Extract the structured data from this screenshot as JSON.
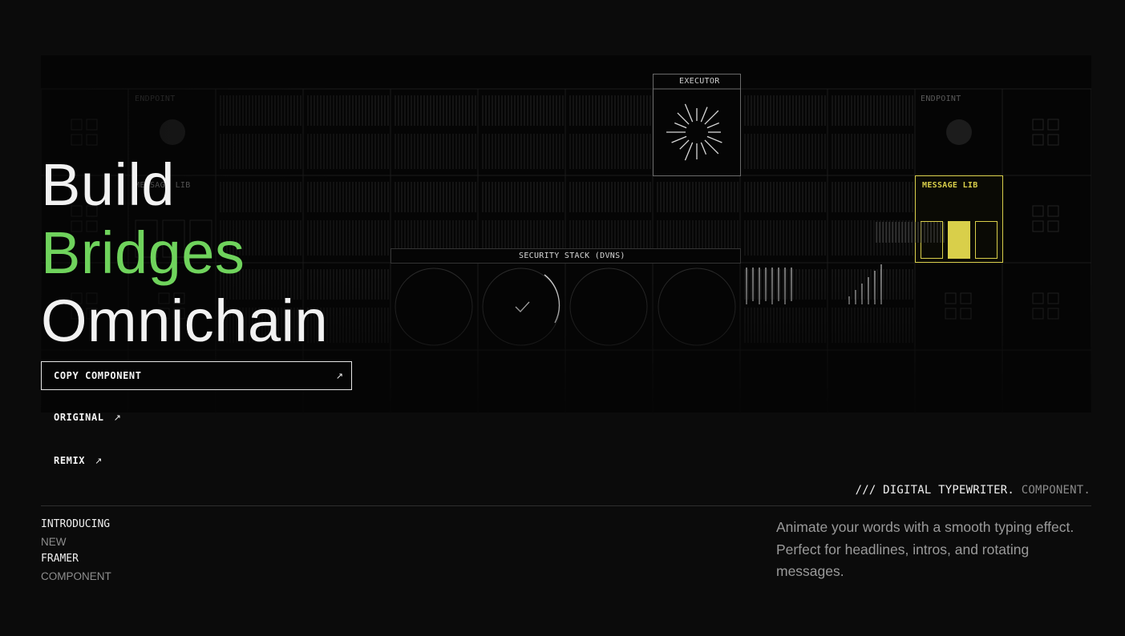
{
  "hero": {
    "headline": {
      "line1": "Build",
      "line2": "Bridges",
      "line3": "Omnichain"
    },
    "diagram": {
      "executor_label": "EXECUTOR",
      "endpoint_left_label": "ENDPOINT",
      "endpoint_right_label": "ENDPOINT",
      "message_lib_left_label": "MESSAGE LIB",
      "message_lib_right_label": "MESSAGE LIB",
      "security_stack_label": "SECURITY STACK (DVNs)",
      "accent_color": "#d9cf4a",
      "check_icon": "check-icon"
    }
  },
  "actions": {
    "copy_component": "COPY COMPONENT",
    "original": "ORIGINAL",
    "remix": "REMIX",
    "arrow_icon": "arrow-up-right-icon"
  },
  "tagline": {
    "part1": "/// DIGITAL TYPEWRITER.",
    "part2": "COMPONENT."
  },
  "intro": {
    "line1": "INTRODUCING",
    "line2": "NEW",
    "line3": "FRAMER",
    "line4": "COMPONENT"
  },
  "description": "Animate your words with a smooth typing effect. Perfect for headlines, intros, and rotating messages.",
  "colors": {
    "background": "#0b0b0b",
    "accent_green": "#6fd35c",
    "accent_yellow": "#d9cf4a"
  }
}
